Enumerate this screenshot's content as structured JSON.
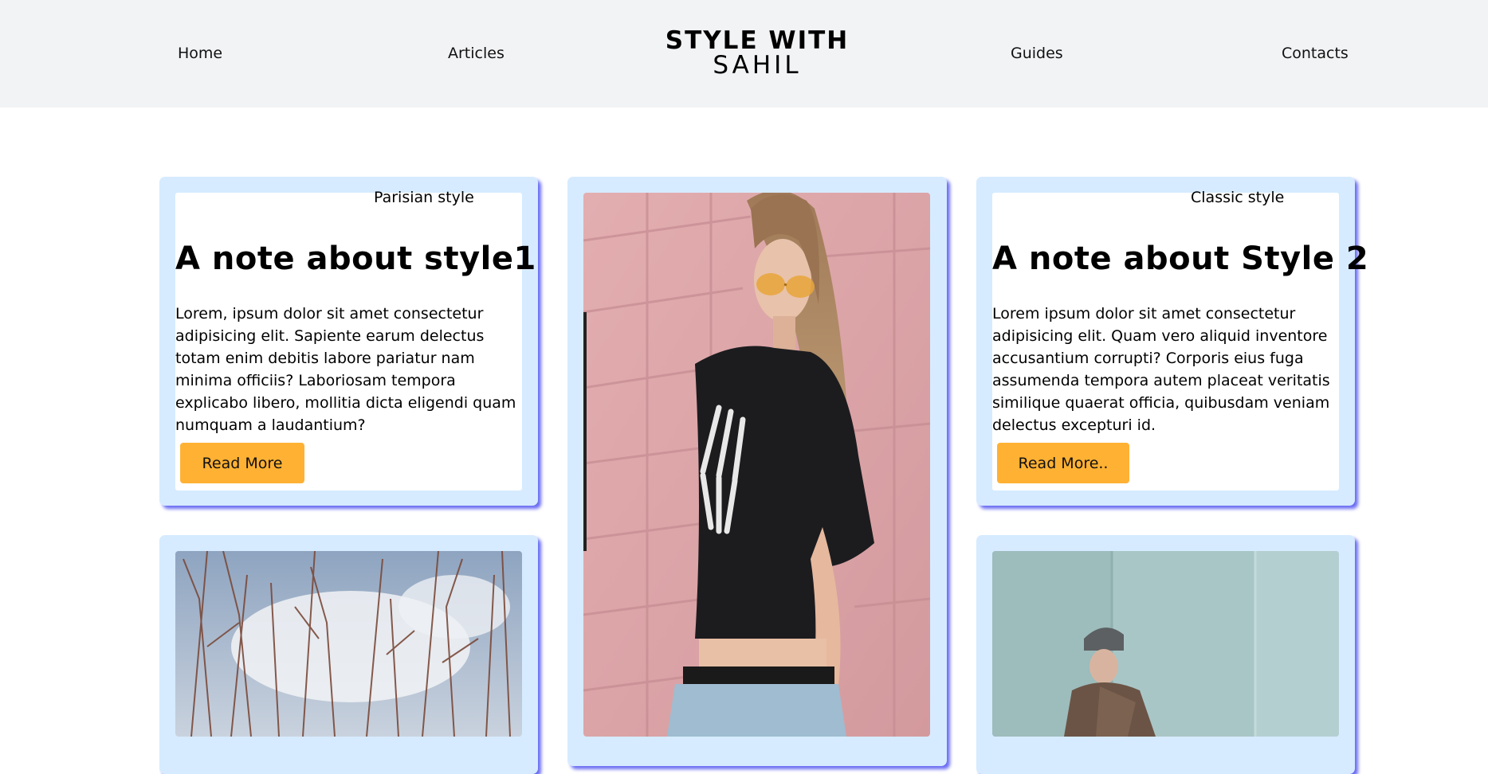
{
  "header": {
    "nav": {
      "home": "Home",
      "articles": "Articles",
      "guides": "Guides",
      "contacts": "Contacts"
    },
    "brand_line1": "STYLE WITH",
    "brand_line2": "SAHIL"
  },
  "cards": {
    "style1": {
      "subtitle": "Parisian style",
      "title": "A note about style1",
      "body": "Lorem, ipsum dolor sit amet consectetur adipisicing elit. Sapiente earum delectus totam enim debitis labore pariatur nam minima officiis? Laboriosam tempora explicabo libero, mollitia dicta eligendi quam numquam a laudantium?",
      "button": "Read More"
    },
    "style2": {
      "subtitle": "Classic style",
      "title": "A note about Style 2",
      "body": "Lorem ipsum dolor sit amet consectetur adipisicing elit. Quam vero aliquid inventore accusantium corrupti? Corporis eius fuga assumenda tempora autem placeat veritatis similique quaerat officia, quibusdam veniam delectus excepturi id.",
      "button": "Read More.."
    }
  },
  "colors": {
    "header_bg": "#f2f3f5",
    "card_bg": "#d6ebff",
    "card_shadow": "#6a6cf2",
    "button_bg": "#ffb133"
  }
}
